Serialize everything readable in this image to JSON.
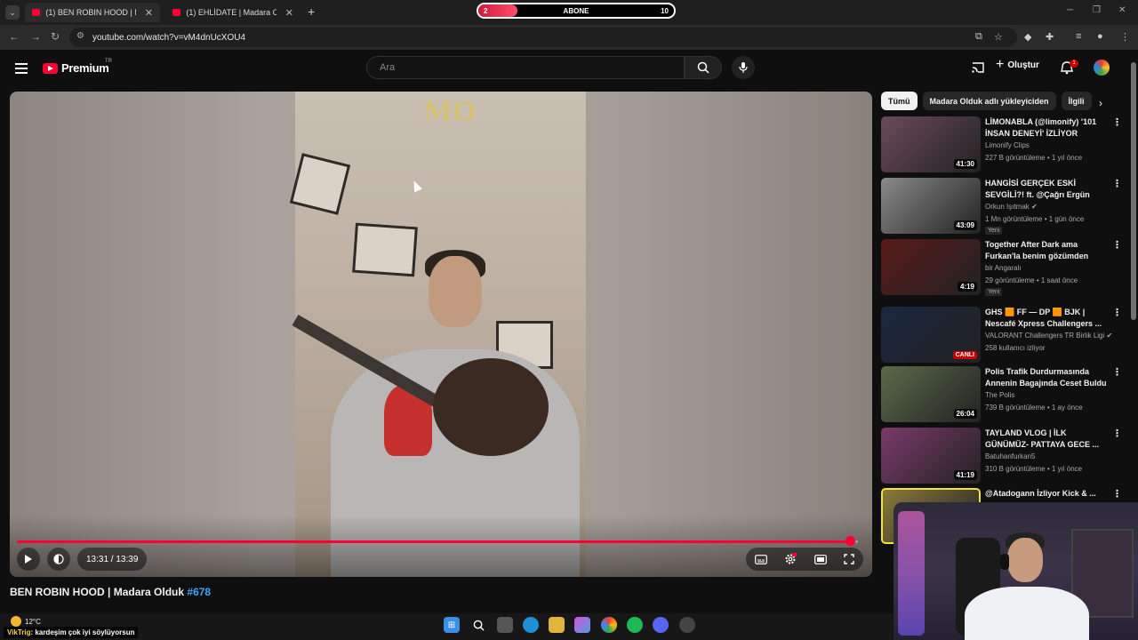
{
  "browser": {
    "tabs": [
      {
        "label": "(1) BEN ROBIN HOOD | Madara",
        "close": "✕"
      },
      {
        "label": "(1) EHLİDATE | Madara Olduk #",
        "close": "✕"
      }
    ],
    "new_tab": "+",
    "url": "youtube.com/watch?v=vM4dnUcXOU4"
  },
  "sub_goal": {
    "current": "2",
    "label": "ABONE",
    "target": "10",
    "progress": 0.2
  },
  "yt": {
    "brand": "Premium",
    "region": "TR",
    "search_placeholder": "Ara",
    "create_label": "Oluştur",
    "notif_count": "1"
  },
  "player": {
    "time": "13:31 / 13:39",
    "progress": 0.99,
    "watermark": "MO"
  },
  "video": {
    "title": "BEN ROBIN HOOD | Madara Olduk ",
    "tag": "#678"
  },
  "chips": [
    "Tümü",
    "Madara Olduk adlı yükleyiciden",
    "İlgili"
  ],
  "recommendations": [
    {
      "title": "LİMONABLA (@limonify) '101 İNSAN DENEYİ' İZLİYOR",
      "channel": "Limonify Clips",
      "meta": "227 B görüntüleme • 1 yıl önce",
      "duration": "41:30",
      "badge": "",
      "thumb_color": "#6b4a5a"
    },
    {
      "title": "HANGİSİ GERÇEK ESKİ SEVGİLİ?! ft. @Çağrı Ergün",
      "channel": "Orkun Işıtmak ✔",
      "meta": "1 Mn görüntüleme • 1 gün önce",
      "duration": "43:09",
      "badge": "Yeni",
      "thumb_color": "#8a8a8a"
    },
    {
      "title": "Together After Dark ama Furkan'la benim gözümden",
      "channel": "bir Angaralı",
      "meta": "29 görüntüleme • 1 saat önce",
      "duration": "4:19",
      "badge": "Yeni",
      "thumb_color": "#5a1a1a"
    },
    {
      "title": "GHS 🟧 FF — DP 🟧 BJK | Nescafé Xpress Challengers ...",
      "channel": "VALORANT Challengers TR Birlik Ligi ✔",
      "meta": "258 kullanıcı izliyor",
      "duration": "CANLI",
      "badge": "",
      "thumb_color": "#1b2740"
    },
    {
      "title": "Polis Trafik Durdurmasında Annenin Bagajında Ceset Buldu",
      "channel": "The Polis",
      "meta": "739 B görüntüleme • 1 ay önce",
      "duration": "26:04",
      "badge": "",
      "thumb_color": "#5a6a4a"
    },
    {
      "title": "TAYLAND VLOG | İLK GÜNÜMÜZ- PATTAYA GECE ...",
      "channel": "Batuhanfurkan5",
      "meta": "310 B görüntüleme • 1 yıl önce",
      "duration": "41:19",
      "badge": "",
      "thumb_color": "#7a3a6a"
    },
    {
      "title": "@Atadogann İzliyor Kick & ...",
      "channel": "",
      "meta": "",
      "duration": "",
      "badge": "",
      "thumb_color": "#8a7a3a"
    }
  ],
  "taskbar": {
    "temperature": "12°C",
    "chat_user": "VikTrig",
    "chat_text": ": kardeşim çok iyi söylüyorsun"
  },
  "colors": {
    "accent": "#ff0033",
    "link": "#3ea6ff",
    "background": "#0f0f0f"
  }
}
